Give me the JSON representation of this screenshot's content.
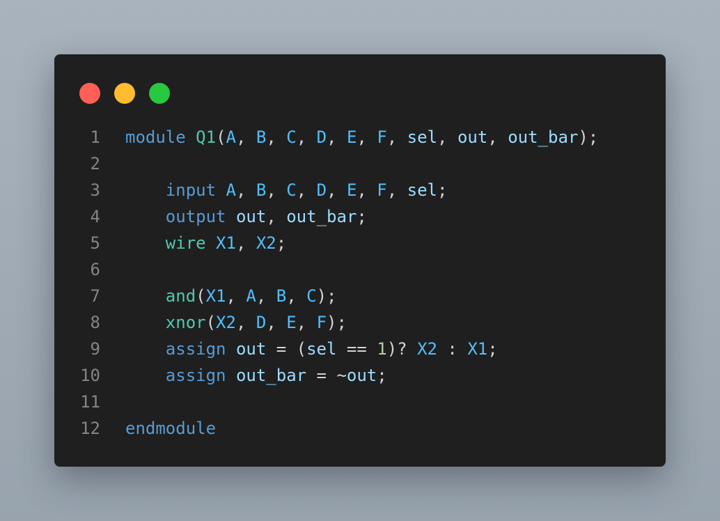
{
  "colors": {
    "background": "#a2acb6",
    "window": "#1f1f1f",
    "close_dot": "#ff5f57",
    "minimize_dot": "#febc2e",
    "maximize_dot": "#28c840",
    "keyword": "#569cd6",
    "type": "#4ec9b0",
    "identifier": "#4fc1ff",
    "variable": "#9cdcfe",
    "number": "#b5cea8",
    "punctuation": "#d4d4d4",
    "line_number": "#858585"
  },
  "code": {
    "line_numbers": [
      "1",
      "2",
      "3",
      "4",
      "5",
      "6",
      "7",
      "8",
      "9",
      "10",
      "11",
      "12"
    ],
    "lines": [
      [
        {
          "text": "module ",
          "cls": "kw"
        },
        {
          "text": "Q1",
          "cls": "ty"
        },
        {
          "text": "(",
          "cls": "p"
        },
        {
          "text": "A",
          "cls": "id"
        },
        {
          "text": ", ",
          "cls": "p"
        },
        {
          "text": "B",
          "cls": "id"
        },
        {
          "text": ", ",
          "cls": "p"
        },
        {
          "text": "C",
          "cls": "id"
        },
        {
          "text": ", ",
          "cls": "p"
        },
        {
          "text": "D",
          "cls": "id"
        },
        {
          "text": ", ",
          "cls": "p"
        },
        {
          "text": "E",
          "cls": "id"
        },
        {
          "text": ", ",
          "cls": "p"
        },
        {
          "text": "F",
          "cls": "id"
        },
        {
          "text": ", ",
          "cls": "p"
        },
        {
          "text": "sel",
          "cls": "var"
        },
        {
          "text": ", ",
          "cls": "p"
        },
        {
          "text": "out",
          "cls": "var"
        },
        {
          "text": ", ",
          "cls": "p"
        },
        {
          "text": "out_bar",
          "cls": "var"
        },
        {
          "text": ");",
          "cls": "p"
        }
      ],
      [],
      [
        {
          "text": "    ",
          "cls": "p"
        },
        {
          "text": "input ",
          "cls": "kw"
        },
        {
          "text": "A",
          "cls": "id"
        },
        {
          "text": ", ",
          "cls": "p"
        },
        {
          "text": "B",
          "cls": "id"
        },
        {
          "text": ", ",
          "cls": "p"
        },
        {
          "text": "C",
          "cls": "id"
        },
        {
          "text": ", ",
          "cls": "p"
        },
        {
          "text": "D",
          "cls": "id"
        },
        {
          "text": ", ",
          "cls": "p"
        },
        {
          "text": "E",
          "cls": "id"
        },
        {
          "text": ", ",
          "cls": "p"
        },
        {
          "text": "F",
          "cls": "id"
        },
        {
          "text": ", ",
          "cls": "p"
        },
        {
          "text": "sel",
          "cls": "var"
        },
        {
          "text": ";",
          "cls": "p"
        }
      ],
      [
        {
          "text": "    ",
          "cls": "p"
        },
        {
          "text": "output ",
          "cls": "kw"
        },
        {
          "text": "out",
          "cls": "var"
        },
        {
          "text": ", ",
          "cls": "p"
        },
        {
          "text": "out_bar",
          "cls": "var"
        },
        {
          "text": ";",
          "cls": "p"
        }
      ],
      [
        {
          "text": "    ",
          "cls": "p"
        },
        {
          "text": "wire ",
          "cls": "ty"
        },
        {
          "text": "X1",
          "cls": "id"
        },
        {
          "text": ", ",
          "cls": "p"
        },
        {
          "text": "X2",
          "cls": "id"
        },
        {
          "text": ";",
          "cls": "p"
        }
      ],
      [],
      [
        {
          "text": "    ",
          "cls": "p"
        },
        {
          "text": "and",
          "cls": "ty"
        },
        {
          "text": "(",
          "cls": "p"
        },
        {
          "text": "X1",
          "cls": "id"
        },
        {
          "text": ", ",
          "cls": "p"
        },
        {
          "text": "A",
          "cls": "id"
        },
        {
          "text": ", ",
          "cls": "p"
        },
        {
          "text": "B",
          "cls": "id"
        },
        {
          "text": ", ",
          "cls": "p"
        },
        {
          "text": "C",
          "cls": "id"
        },
        {
          "text": ");",
          "cls": "p"
        }
      ],
      [
        {
          "text": "    ",
          "cls": "p"
        },
        {
          "text": "xnor",
          "cls": "ty"
        },
        {
          "text": "(",
          "cls": "p"
        },
        {
          "text": "X2",
          "cls": "id"
        },
        {
          "text": ", ",
          "cls": "p"
        },
        {
          "text": "D",
          "cls": "id"
        },
        {
          "text": ", ",
          "cls": "p"
        },
        {
          "text": "E",
          "cls": "id"
        },
        {
          "text": ", ",
          "cls": "p"
        },
        {
          "text": "F",
          "cls": "id"
        },
        {
          "text": ");",
          "cls": "p"
        }
      ],
      [
        {
          "text": "    ",
          "cls": "p"
        },
        {
          "text": "assign ",
          "cls": "kw"
        },
        {
          "text": "out",
          "cls": "var"
        },
        {
          "text": " = (",
          "cls": "p"
        },
        {
          "text": "sel",
          "cls": "var"
        },
        {
          "text": " == ",
          "cls": "p"
        },
        {
          "text": "1",
          "cls": "num"
        },
        {
          "text": ")? ",
          "cls": "p"
        },
        {
          "text": "X2",
          "cls": "id"
        },
        {
          "text": " : ",
          "cls": "p"
        },
        {
          "text": "X1",
          "cls": "id"
        },
        {
          "text": ";",
          "cls": "p"
        }
      ],
      [
        {
          "text": "    ",
          "cls": "p"
        },
        {
          "text": "assign ",
          "cls": "kw"
        },
        {
          "text": "out_bar",
          "cls": "var"
        },
        {
          "text": " = ~",
          "cls": "p"
        },
        {
          "text": "out",
          "cls": "var"
        },
        {
          "text": ";",
          "cls": "p"
        }
      ],
      [],
      [
        {
          "text": "endmodule",
          "cls": "kw"
        }
      ]
    ]
  }
}
